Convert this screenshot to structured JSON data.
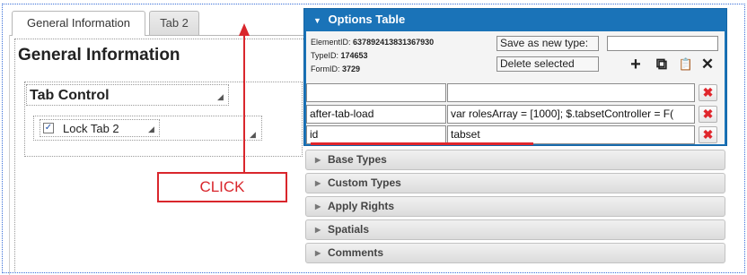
{
  "tabs": [
    {
      "label": "General Information"
    },
    {
      "label": "Tab 2"
    }
  ],
  "page_title": "General Information",
  "tab_control": {
    "title": "Tab Control",
    "lock_label": "Lock Tab 2",
    "lock_checked": "✓"
  },
  "annotation": {
    "click_label": "CLICK",
    "color": "#d9262c"
  },
  "options_table": {
    "title": "Options Table",
    "element_id_label": "ElementID:",
    "element_id": "637892413831367930",
    "type_id_label": "TypeID:",
    "type_id": "174653",
    "form_id_label": "FormID:",
    "form_id": "3729",
    "save_as_new_type_label": "Save as new type:",
    "save_as_new_type_value": "",
    "delete_selected_label": "Delete selected",
    "toolbar": {
      "add_icon": "+",
      "copy_icon": "⧉",
      "paste_icon": "📋",
      "clear_icon": "✕"
    },
    "rows": [
      {
        "key": "",
        "value": ""
      },
      {
        "key": "after-tab-load",
        "value": "var rolesArray = [1000]; $.tabsetController = F("
      },
      {
        "key": "id",
        "value": "tabset"
      }
    ],
    "delete_icon": "✖",
    "accent_color": "#1a73b8"
  },
  "sections": [
    {
      "label": "Base Types"
    },
    {
      "label": "Custom Types"
    },
    {
      "label": "Apply Rights"
    },
    {
      "label": "Spatials"
    },
    {
      "label": "Comments"
    }
  ]
}
